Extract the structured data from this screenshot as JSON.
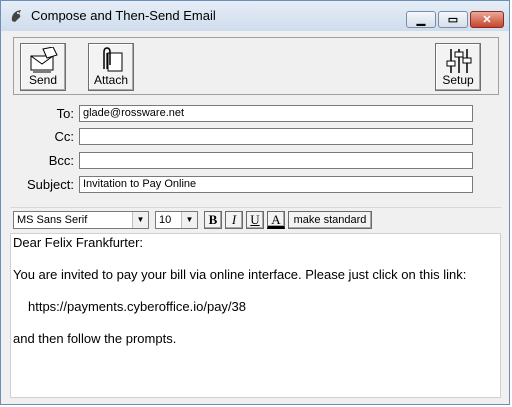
{
  "window": {
    "title": "Compose and Then-Send Email"
  },
  "toolbar": {
    "send_label": "Send",
    "attach_label": "Attach",
    "setup_label": "Setup"
  },
  "fields": {
    "to_label": "To:",
    "to_value": "glade@rossware.net",
    "cc_label": "Cc:",
    "cc_value": "",
    "bcc_label": "Bcc:",
    "bcc_value": "",
    "subject_label": "Subject:",
    "subject_value": "Invitation to Pay Online"
  },
  "format": {
    "font_name": "MS Sans Serif",
    "font_size": "10",
    "bold": "B",
    "italic": "I",
    "underline": "U",
    "color": "A",
    "make_standard": "make standard"
  },
  "message": {
    "greeting": "Dear Felix Frankfurter:",
    "line1": "You are invited to pay your bill via online interface.  Please just click on this link:",
    "link": "https://payments.cyberoffice.io/pay/38",
    "line2": "and then follow the prompts."
  }
}
